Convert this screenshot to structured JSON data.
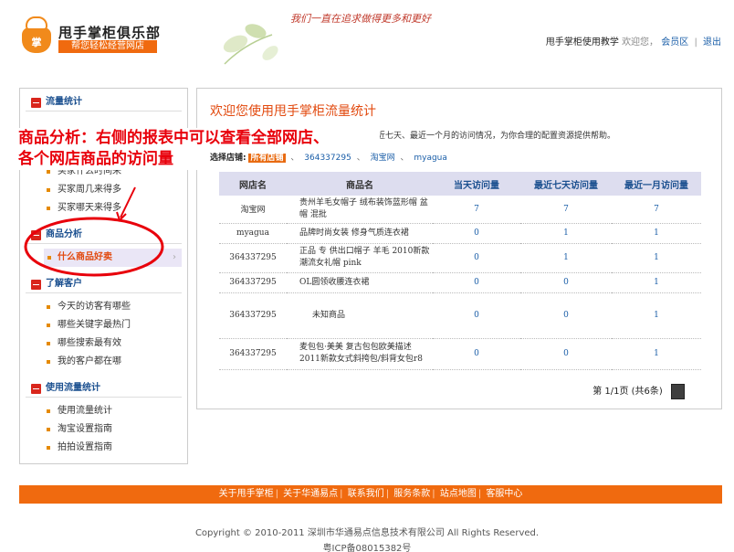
{
  "header": {
    "brand_title": "甩手掌柜俱乐部",
    "brand_sub": "帮您轻松经营网店",
    "slogan": "我们一直在追求做得更多和更好",
    "teach_link": "甩手掌柜使用教学",
    "welcome": "欢迎您，",
    "member_link": "会员区",
    "logout_link": "退出",
    "logo_char": "掌"
  },
  "annotation": {
    "line1": "商品分析：右侧的报表中可以查看全部网店、",
    "line2": "各个网店商品的访问量",
    "color": "#e8000b"
  },
  "sidebar": {
    "sections": [
      {
        "title": "流量统计",
        "items": [
          "买家什么时间来",
          "买家周几来得多",
          "买家哪天来得多"
        ]
      },
      {
        "title": "商品分析",
        "items": [
          "什么商品好卖"
        ],
        "active_index": 0,
        "active_arrow": "›"
      },
      {
        "title": "了解客户",
        "items": [
          "今天的访客有哪些",
          "哪些关键字最热门",
          "哪些搜索最有效",
          "我的客户都在哪"
        ]
      },
      {
        "title": "使用流量统计",
        "items": [
          "使用流量统计",
          "淘宝设置指南",
          "拍拍设置指南"
        ]
      }
    ]
  },
  "main": {
    "welcome": "欢迎您使用甩手掌柜流量统计",
    "intro": "天、最近七天、最近一个月的访问情况，为你合理的配置资源提供帮助。",
    "store_label": "选择店铺:",
    "store_selected": "所有店铺",
    "store_options": [
      "364337295",
      "淘宝网",
      "myagua"
    ],
    "table": {
      "headers": [
        "网店名",
        "商品名",
        "当天访问量",
        "最近七天访问量",
        "最近一月访问量"
      ],
      "rows": [
        {
          "store": "淘宝网",
          "product": "贵州羊毛女帽子 绒布装饰蓝形帽 盆帽 混批",
          "today": "7",
          "week": "7",
          "month": "7"
        },
        {
          "store": "myagua",
          "product": "品牌时尚女装 修身气质连衣裙",
          "today": "0",
          "week": "1",
          "month": "1"
        },
        {
          "store": "364337295",
          "product": "正品 专 供出口帽子 羊毛 2010新款潮流女礼帽 pink",
          "today": "0",
          "week": "1",
          "month": "1"
        },
        {
          "store": "364337295",
          "product": "OL圆领收腰连衣裙",
          "today": "0",
          "week": "0",
          "month": "1"
        },
        {
          "store": "364337295",
          "product": "未知商品",
          "today": "0",
          "week": "0",
          "month": "1"
        },
        {
          "store": "364337295",
          "product": "麦包包·美美 复古包包欧美描述 2011新款女式斜挎包/斜背女包r8",
          "today": "0",
          "week": "0",
          "month": "1"
        }
      ]
    },
    "pager": "第 1/1页 (共6条)"
  },
  "footer": {
    "links": [
      "关于甩手掌柜",
      "关于华通易点",
      "联系我们",
      "服务条款",
      "站点地图",
      "客服中心"
    ],
    "copyright": "Copyright © 2010-2011 深圳市华通易点信息技术有限公司  All Rights Reserved.",
    "icp": "粤ICP备08015382号"
  },
  "colors": {
    "accent": "#f06a0f",
    "link": "#1a5ea8",
    "active": "#e24a0f"
  }
}
